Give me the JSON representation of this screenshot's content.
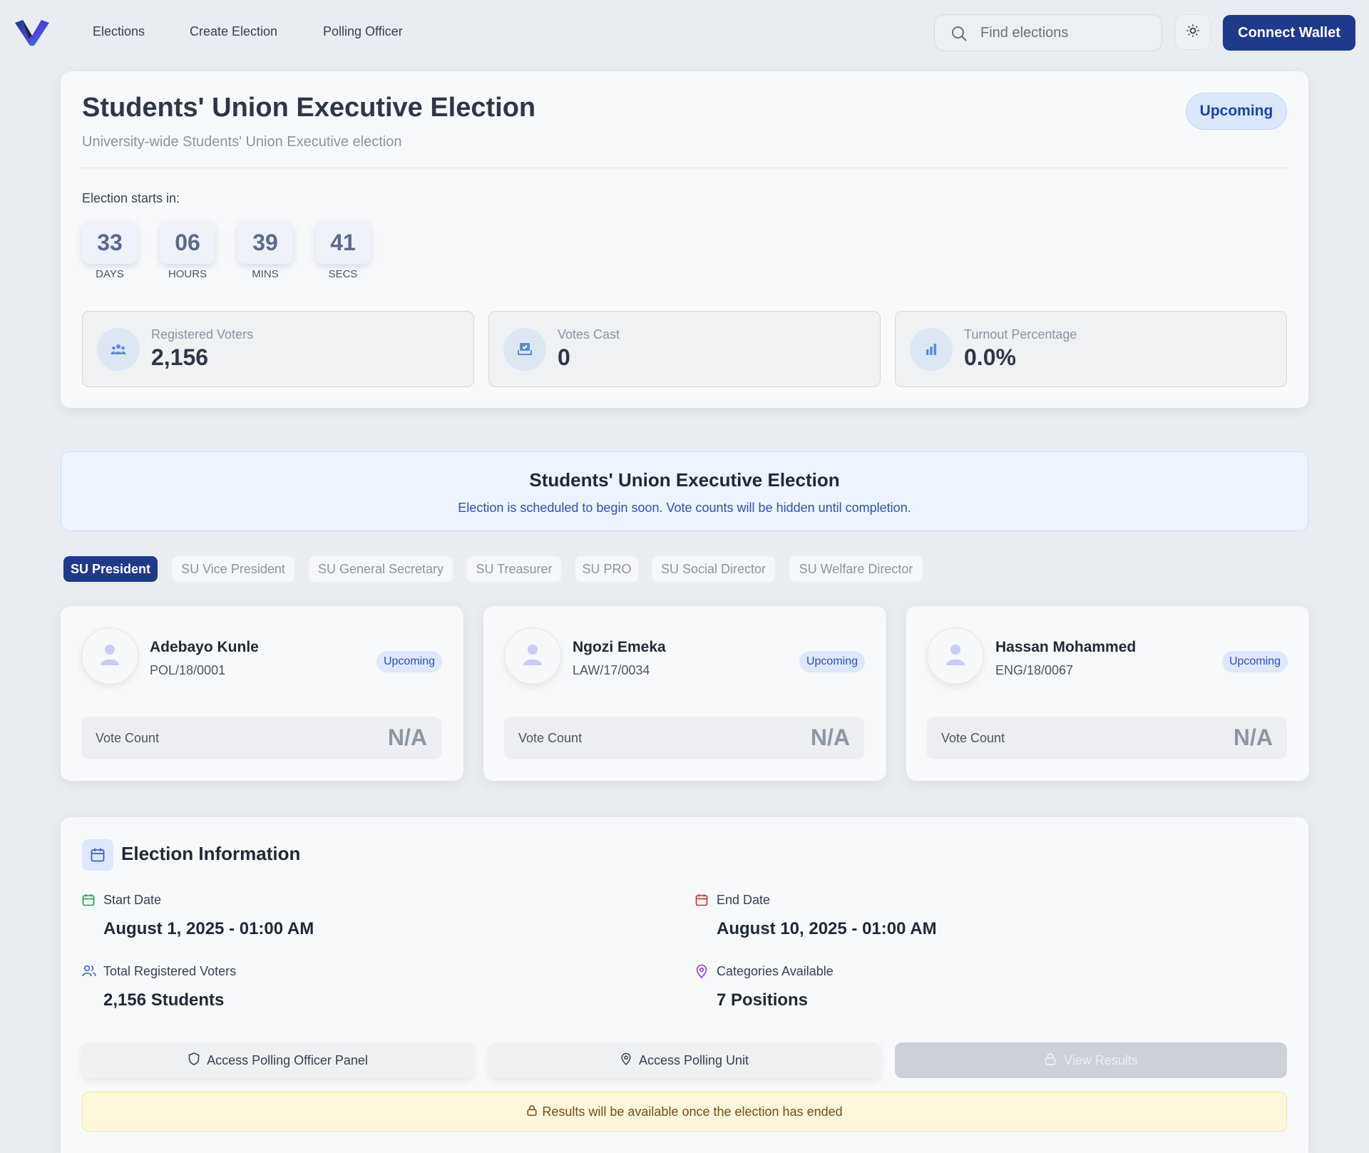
{
  "nav": {
    "links": [
      "Elections",
      "Create Election",
      "Polling Officer"
    ],
    "search_placeholder": "Find elections",
    "connect_wallet": "Connect Wallet"
  },
  "election": {
    "title": "Students' Union Executive Election",
    "subtitle": "University-wide Students' Union Executive election",
    "status": "Upcoming",
    "starts_label": "Election starts in:",
    "countdown": [
      {
        "value": "33",
        "unit": "DAYS"
      },
      {
        "value": "06",
        "unit": "HOURS"
      },
      {
        "value": "39",
        "unit": "MINS"
      },
      {
        "value": "41",
        "unit": "SECS"
      }
    ],
    "stats": [
      {
        "label": "Registered Voters",
        "value": "2,156",
        "icon": "users-icon"
      },
      {
        "label": "Votes Cast",
        "value": "0",
        "icon": "ballot-box-icon"
      },
      {
        "label": "Turnout Percentage",
        "value": "0.0%",
        "icon": "bar-chart-icon"
      }
    ]
  },
  "banner": {
    "title": "Students' Union Executive Election",
    "message": "Election is scheduled to begin soon. Vote counts will be hidden until completion."
  },
  "tabs": [
    {
      "label": "SU President",
      "active": true
    },
    {
      "label": "SU Vice President",
      "active": false
    },
    {
      "label": "SU General Secretary",
      "active": false
    },
    {
      "label": "SU Treasurer",
      "active": false
    },
    {
      "label": "SU PRO",
      "active": false
    },
    {
      "label": "SU Social Director",
      "active": false
    },
    {
      "label": "SU Welfare Director",
      "active": false
    }
  ],
  "candidates": [
    {
      "name": "Adebayo Kunle",
      "id": "POL/18/0001",
      "status": "Upcoming",
      "vote_label": "Vote Count",
      "vote_value": "N/A"
    },
    {
      "name": "Ngozi Emeka",
      "id": "LAW/17/0034",
      "status": "Upcoming",
      "vote_label": "Vote Count",
      "vote_value": "N/A"
    },
    {
      "name": "Hassan Mohammed",
      "id": "ENG/18/0067",
      "status": "Upcoming",
      "vote_label": "Vote Count",
      "vote_value": "N/A"
    }
  ],
  "info": {
    "heading": "Election Information",
    "start_label": "Start Date",
    "start_value": "August 1, 2025 - 01:00 AM",
    "end_label": "End Date",
    "end_value": "August 10, 2025 - 01:00 AM",
    "voters_label": "Total Registered Voters",
    "voters_value": "2,156 Students",
    "categories_label": "Categories Available",
    "categories_value": "7 Positions",
    "actions": {
      "polling_officer": "Access Polling Officer Panel",
      "polling_unit": "Access Polling Unit",
      "view_results": "View Results"
    },
    "notice": "Results will be available once the election has ended"
  },
  "colors": {
    "brand": "#1e3a8a",
    "page_bg": "#e9ecf0",
    "card_bg": "#f8f9fa",
    "info_blue": "#2f4fb8",
    "notice_bg": "#fdf8dc"
  }
}
